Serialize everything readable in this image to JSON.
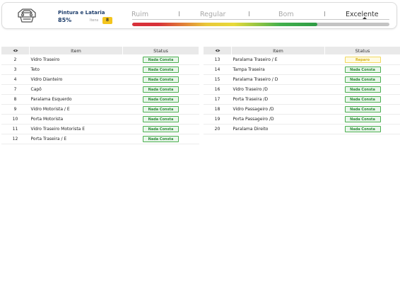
{
  "category": {
    "title": "Pintura e Lataria",
    "percent": "85%",
    "itens_label": "Itens",
    "itens_count": "8"
  },
  "scale": {
    "labels": [
      "Ruim",
      "Regular",
      "Bom",
      "Excelente"
    ],
    "active": "Excelente",
    "progress_fraction": 0.72
  },
  "table_headers": {
    "col_item": "Item",
    "col_status": "Status"
  },
  "left_table": [
    {
      "num": "2",
      "item": "Vidro Traseiro",
      "status": "Nada Consta",
      "kind": "ok"
    },
    {
      "num": "3",
      "item": "Teto",
      "status": "Nada Consta",
      "kind": "ok"
    },
    {
      "num": "4",
      "item": "Vidro Dianteiro",
      "status": "Nada Consta",
      "kind": "ok"
    },
    {
      "num": "7",
      "item": "Capô",
      "status": "Nada Consta",
      "kind": "ok"
    },
    {
      "num": "8",
      "item": "Paralama Esquerdo",
      "status": "Nada Consta",
      "kind": "ok"
    },
    {
      "num": "9",
      "item": "Vidro Motorista / E",
      "status": "Nada Consta",
      "kind": "ok"
    },
    {
      "num": "10",
      "item": "Porta Motorista",
      "status": "Nada Consta",
      "kind": "ok"
    },
    {
      "num": "11",
      "item": "Vidro Traseiro Motorista E",
      "status": "Nada Consta",
      "kind": "ok"
    },
    {
      "num": "12",
      "item": "Porta Traseira / E",
      "status": "Nada Consta",
      "kind": "ok"
    }
  ],
  "right_table": [
    {
      "num": "13",
      "item": "Paralama Traseiro / E",
      "status": "Reparo",
      "kind": "warn"
    },
    {
      "num": "14",
      "item": "Tampa Traseira",
      "status": "Nada Consta",
      "kind": "ok"
    },
    {
      "num": "15",
      "item": "Paralama Traseiro / D",
      "status": "Nada Consta",
      "kind": "ok"
    },
    {
      "num": "16",
      "item": "Vidro Traseiro /D",
      "status": "Nada Consta",
      "kind": "ok"
    },
    {
      "num": "17",
      "item": "Porta Traseira /D",
      "status": "Nada Consta",
      "kind": "ok"
    },
    {
      "num": "18",
      "item": "Vidro Passageiro /D",
      "status": "Nada Consta",
      "kind": "ok"
    },
    {
      "num": "19",
      "item": "Porta Passageiro /D",
      "status": "Nada Consta",
      "kind": "ok"
    },
    {
      "num": "20",
      "item": "Paralama Direito",
      "status": "Nada Consta",
      "kind": "ok"
    }
  ],
  "icons": {
    "category_icon": "car-body-icon",
    "header_icon": "eye-icon"
  },
  "colors": {
    "ok_border": "#4caf50",
    "ok_text": "#2e8a3a",
    "warn_border": "#f0d860",
    "warn_text": "#d6b21a",
    "count_badge": "#f4c51d",
    "title_color": "#1d3d6b"
  }
}
